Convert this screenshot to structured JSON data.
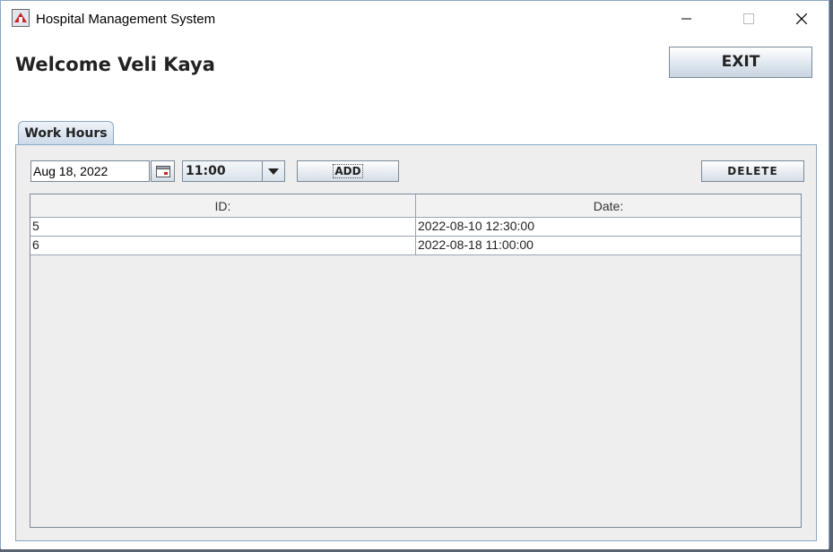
{
  "window": {
    "title": "Hospital Management System",
    "app_icon": "hospital-app-icon",
    "controls": [
      "minimize-icon",
      "maximize-icon",
      "close-icon"
    ]
  },
  "header": {
    "welcome": "Welcome Veli Kaya",
    "exit_label": "EXIT"
  },
  "tabs": [
    {
      "label": "Work Hours",
      "selected": true
    }
  ],
  "form": {
    "date_value": "Aug 18, 2022",
    "calendar_icon": "calendar-icon",
    "time_value": "11:00",
    "add_label": "ADD",
    "delete_label": "DELETE"
  },
  "table": {
    "columns": [
      "ID:",
      "Date:"
    ],
    "rows": [
      [
        "5",
        "2022-08-10 12:30:00"
      ],
      [
        "6",
        "2022-08-18 11:00:00"
      ]
    ]
  },
  "colors": {
    "accent_border": "#8aa9c9",
    "panel_background": "#eeeeee"
  }
}
